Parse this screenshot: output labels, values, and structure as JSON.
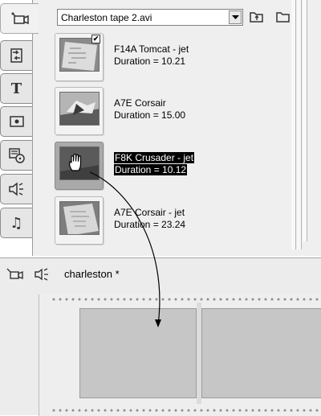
{
  "album": {
    "tabs": [
      {
        "name": "video-tab",
        "icon": "camcorder-icon",
        "active": true
      },
      {
        "name": "transitions-tab",
        "icon": "transitions-icon"
      },
      {
        "name": "titles-tab",
        "icon": "title-icon",
        "glyph": "T"
      },
      {
        "name": "still-images-tab",
        "icon": "photo-icon"
      },
      {
        "name": "disc-menus-tab",
        "icon": "disc-menu-icon"
      },
      {
        "name": "sound-effects-tab",
        "icon": "speaker-icon"
      },
      {
        "name": "music-tab",
        "icon": "treble-clef-icon",
        "glyph": "𝄞"
      }
    ],
    "file_select": {
      "value": "Charleston tape 2.avi"
    },
    "toolbar": {
      "up_icon": "folder-up-icon",
      "open_icon": "folder-open-icon"
    },
    "clips": [
      {
        "title": "F14A Tomcat - jet",
        "duration": "Duration = 10.21",
        "checked": true
      },
      {
        "title": "A7E Corsair",
        "duration": "Duration = 15.00"
      },
      {
        "title": "F8K Crusader - jet",
        "duration": "Duration = 10.12",
        "selected": true
      },
      {
        "title": "A7E Corsair - jet",
        "duration": "Duration = 23.24"
      }
    ]
  },
  "timeline": {
    "title": "charleston *",
    "icons": [
      "camcorder-icon",
      "speaker-icon"
    ]
  },
  "colors": {
    "panel_bg": "#efefef",
    "slot_fill": "#c6c6c6",
    "selection_bg": "#000000"
  }
}
